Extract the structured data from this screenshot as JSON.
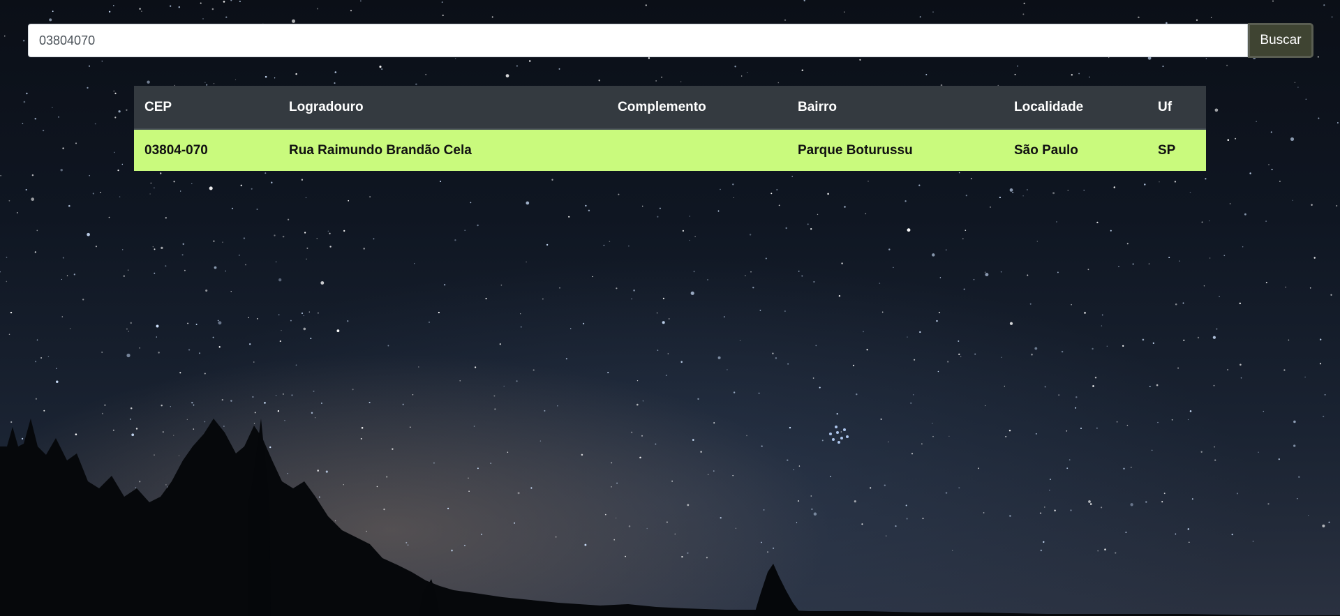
{
  "search": {
    "value": "03804070",
    "button_label": "Buscar"
  },
  "table": {
    "headers": [
      "CEP",
      "Logradouro",
      "Complemento",
      "Bairro",
      "Localidade",
      "Uf"
    ],
    "rows": [
      [
        "03804-070",
        "Rua Raimundo Brandão Cela",
        "",
        "Parque Boturussu",
        "São Paulo",
        "SP"
      ]
    ]
  },
  "colors": {
    "header_background": "#343a40",
    "row_highlight": "#c9fa7d",
    "button_background": "#3f4432"
  },
  "background": {
    "description_icon": "night-sky-background"
  }
}
